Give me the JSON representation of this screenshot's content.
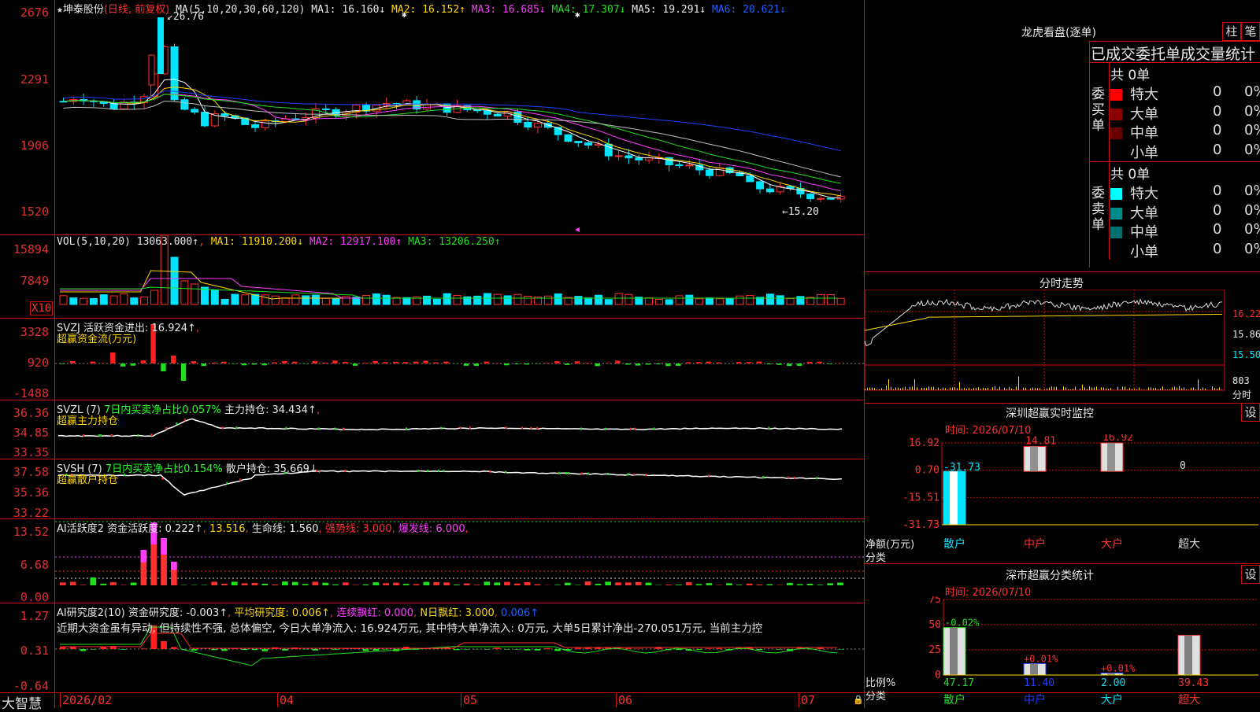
{
  "main_chart": {
    "title_star": "★",
    "stock_name": "坤泰股份",
    "period": "(日线, 前复权)",
    "ma_label": "MA(5,10,20,30,60,120)",
    "ma1": "MA1: 16.160↓",
    "ma2": "MA2: 16.152↑",
    "ma3": "MA3: 16.685↓",
    "ma4": "MA4: 17.307↓",
    "ma5": "MA5: 19.291↓",
    "ma6": "MA6: 20.621↓",
    "axis": [
      "2676",
      "2291",
      "1906",
      "1520"
    ],
    "high_label": "26.76",
    "low_label": "15.20"
  },
  "vol_panel": {
    "label": "VOL(5,10,20)",
    "value": "13063.000↑",
    "ma1": "MA1: 11910.200↓",
    "ma2": "MA2: 12917.100↑",
    "ma3": "MA3: 13206.250↑",
    "axis": [
      "15894",
      "7849"
    ],
    "unit": "X10"
  },
  "svzj_panel": {
    "label": "SVZJ  活跃资金进出: 16.924↑",
    "sub": "超赢资金流(万元)",
    "axis": [
      "3328",
      "920",
      "-1488"
    ]
  },
  "svzl_panel": {
    "label": "SVZL (7)",
    "desc": "7日内买卖净占比0.057%",
    "hold": "主力持仓: 34.434↑",
    "sub": "超赢主力持仓",
    "axis": [
      "36.36",
      "34.85",
      "33.35"
    ]
  },
  "svsh_panel": {
    "label": "SVSH (7)",
    "desc": "7日内买卖净占比0.154%",
    "hold": "散户持仓: 35.669↓",
    "sub": "超赢散户持仓",
    "axis": [
      "37.58",
      "35.36",
      "33.22"
    ]
  },
  "ai_active_panel": {
    "label": "AI活跃度2 资金活跃度: 0.222↑",
    "v2": "13.516",
    "life": "生命线: 1.560",
    "strong": "强势线: 3.000",
    "burst": "爆发线: 6.000",
    "axis": [
      "13.52",
      "6.68",
      "0.00"
    ]
  },
  "ai_research_panel": {
    "label": "AI研究度2(10) 资金研究度: -0.003↑",
    "avg": "平均研究度: 0.006↑",
    "cont": "连续飘红: 0.000",
    "nday": "N日飘红: 3.000",
    "nval": "0.006↑",
    "comment": "近期大资金虽有异动, 但持续性不强, 总体偏空, 今日大单净流入: 16.924万元, 其中特大单净流入: 0万元, 大单5日累计净出-270.051万元, 当前主力控",
    "axis": [
      "1.27",
      "0.31",
      "-0.64"
    ]
  },
  "time_axis": {
    "brand": "大智慧",
    "labels": [
      "2026/02",
      "04",
      "05",
      "06",
      "07"
    ]
  },
  "dragon_tiger": {
    "title": "龙虎看盘(逐单)",
    "btn1": "柱",
    "btn2": "笔",
    "header": "已成交委托单成交量统计",
    "buy_total": "共 0单",
    "sell_total": "共 0单",
    "buy_label": "委买单",
    "sell_label": "委卖单",
    "buy_rows": [
      {
        "name": "特大",
        "count": "0",
        "pct": "0%",
        "color": "#ff0000"
      },
      {
        "name": "大单",
        "count": "0",
        "pct": "0%",
        "color": "#8b0000"
      },
      {
        "name": "中单",
        "count": "0",
        "pct": "0%",
        "color": "#6b0000"
      },
      {
        "name": "小单",
        "count": "0",
        "pct": "0%",
        "color": "#000000"
      }
    ],
    "sell_rows": [
      {
        "name": "特大",
        "count": "0",
        "pct": "0%",
        "color": "#00ffff"
      },
      {
        "name": "大单",
        "count": "0",
        "pct": "0%",
        "color": "#008b8b"
      },
      {
        "name": "中单",
        "count": "0",
        "pct": "0%",
        "color": "#007070"
      },
      {
        "name": "小单",
        "count": "0",
        "pct": "0%",
        "color": "#000000"
      }
    ]
  },
  "intraday": {
    "title": "分时走势",
    "price_labels": [
      "16.22",
      "15.86",
      "15.50"
    ],
    "vol_label": "803",
    "vol_unit": "分时"
  },
  "sz_monitor": {
    "title": "深圳超赢实时监控",
    "settings": "设",
    "date": "时间: 2026/07/10",
    "axis": [
      "16.92",
      "0.70",
      "-15.51",
      "-31.73"
    ],
    "bar_values": [
      "-31.73",
      "14.81",
      "16.92",
      "0"
    ],
    "ylabel": "净额(万元)",
    "xlabel": "分类",
    "categories": [
      "散户",
      "中户",
      "大户",
      "超大"
    ]
  },
  "sz_stats": {
    "title": "深市超赢分类统计",
    "settings": "设",
    "date": "时间: 2026/07/10",
    "axis": [
      "75",
      "50",
      "25",
      "0"
    ],
    "delta_labels": [
      "-0.02%",
      "+0.01%",
      "+0.01%"
    ],
    "values": [
      "47.17",
      "11.40",
      "2.00",
      "39.43"
    ],
    "ylabel": "比例%",
    "xlabel": "分类",
    "categories": [
      "散户",
      "中户",
      "大户",
      "超大"
    ]
  },
  "chart_data": [
    {
      "type": "bar",
      "title": "深圳超赢实时监控",
      "ylabel": "净额(万元)",
      "categories": [
        "散户",
        "中户",
        "大户",
        "超大"
      ],
      "values": [
        -31.73,
        14.81,
        16.92,
        0
      ],
      "ylim": [
        -31.73,
        16.92
      ]
    },
    {
      "type": "bar",
      "title": "深市超赢分类统计",
      "ylabel": "比例%",
      "categories": [
        "散户",
        "中户",
        "大户",
        "超大"
      ],
      "values": [
        47.17,
        11.4,
        2.0,
        39.43
      ],
      "ylim": [
        0,
        75
      ]
    }
  ]
}
